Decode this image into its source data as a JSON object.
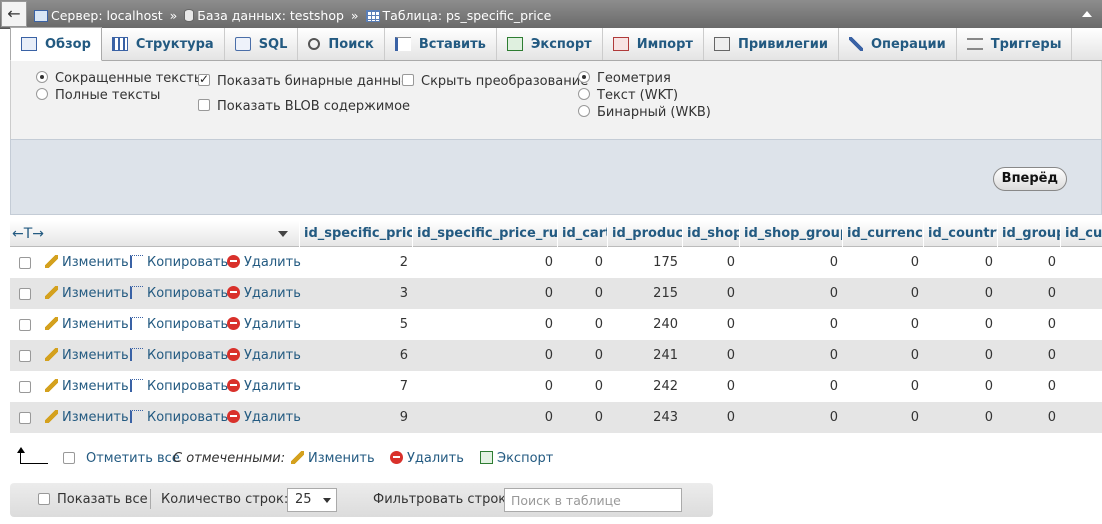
{
  "breadcrumb": {
    "server": "Сервер: localhost",
    "database": "База данных: testshop",
    "table": "Таблица: ps_specific_price",
    "separator": "»"
  },
  "tabs": [
    {
      "label": "Обзор",
      "icon": "browse-icon",
      "active": true
    },
    {
      "label": "Структура",
      "icon": "structure-icon"
    },
    {
      "label": "SQL",
      "icon": "sql-icon"
    },
    {
      "label": "Поиск",
      "icon": "search-icon"
    },
    {
      "label": "Вставить",
      "icon": "insert-icon"
    },
    {
      "label": "Экспорт",
      "icon": "export-icon"
    },
    {
      "label": "Импорт",
      "icon": "import-icon"
    },
    {
      "label": "Привилегии",
      "icon": "privileges-icon"
    },
    {
      "label": "Операции",
      "icon": "operations-icon"
    },
    {
      "label": "Триггеры",
      "icon": "triggers-icon"
    }
  ],
  "options": {
    "text_short": "Сокращенные тексты",
    "text_full": "Полные тексты",
    "show_binary": "Показать бинарные данные",
    "show_blob": "Показать BLOB содержимое",
    "hide_transform": "Скрыть преобразование",
    "geometry": "Геометрия",
    "text_wkt": "Текст (WKT)",
    "binary_wkb": "Бинарный (WKB)"
  },
  "forward_button": "Вперёд",
  "columns": [
    "id_specific_price",
    "id_specific_price_rule",
    "id_cart",
    "id_product",
    "id_shop",
    "id_shop_group",
    "id_currency",
    "id_country",
    "id_group",
    "id_cus"
  ],
  "row_actions": {
    "edit": "Изменить",
    "copy": "Копировать",
    "delete": "Удалить"
  },
  "rows": [
    {
      "id_specific_price": "2",
      "id_specific_price_rule": "0",
      "id_cart": "0",
      "id_product": "175",
      "id_shop": "0",
      "id_shop_group": "0",
      "id_currency": "0",
      "id_country": "0",
      "id_group": "0"
    },
    {
      "id_specific_price": "3",
      "id_specific_price_rule": "0",
      "id_cart": "0",
      "id_product": "215",
      "id_shop": "0",
      "id_shop_group": "0",
      "id_currency": "0",
      "id_country": "0",
      "id_group": "0"
    },
    {
      "id_specific_price": "5",
      "id_specific_price_rule": "0",
      "id_cart": "0",
      "id_product": "240",
      "id_shop": "0",
      "id_shop_group": "0",
      "id_currency": "0",
      "id_country": "0",
      "id_group": "0"
    },
    {
      "id_specific_price": "6",
      "id_specific_price_rule": "0",
      "id_cart": "0",
      "id_product": "241",
      "id_shop": "0",
      "id_shop_group": "0",
      "id_currency": "0",
      "id_country": "0",
      "id_group": "0"
    },
    {
      "id_specific_price": "7",
      "id_specific_price_rule": "0",
      "id_cart": "0",
      "id_product": "242",
      "id_shop": "0",
      "id_shop_group": "0",
      "id_currency": "0",
      "id_country": "0",
      "id_group": "0"
    },
    {
      "id_specific_price": "9",
      "id_specific_price_rule": "0",
      "id_cart": "0",
      "id_product": "243",
      "id_shop": "0",
      "id_shop_group": "0",
      "id_currency": "0",
      "id_country": "0",
      "id_group": "0"
    }
  ],
  "bulk": {
    "check_all": "Отметить все",
    "with_selected": "С отмеченными:",
    "edit": "Изменить",
    "delete": "Удалить",
    "export": "Экспорт"
  },
  "footer": {
    "show_all": "Показать все",
    "row_count_label": "Количество строк:",
    "row_count_value": "25",
    "filter_label": "Фильтровать строки:",
    "filter_placeholder": "Поиск в таблице"
  },
  "colors": {
    "link": "#235a81",
    "tab_bar": "#e4e4e4",
    "nav_panel": "#dde3ea",
    "row_alt": "#e5e5e5",
    "delete_icon": "#d9312b"
  }
}
